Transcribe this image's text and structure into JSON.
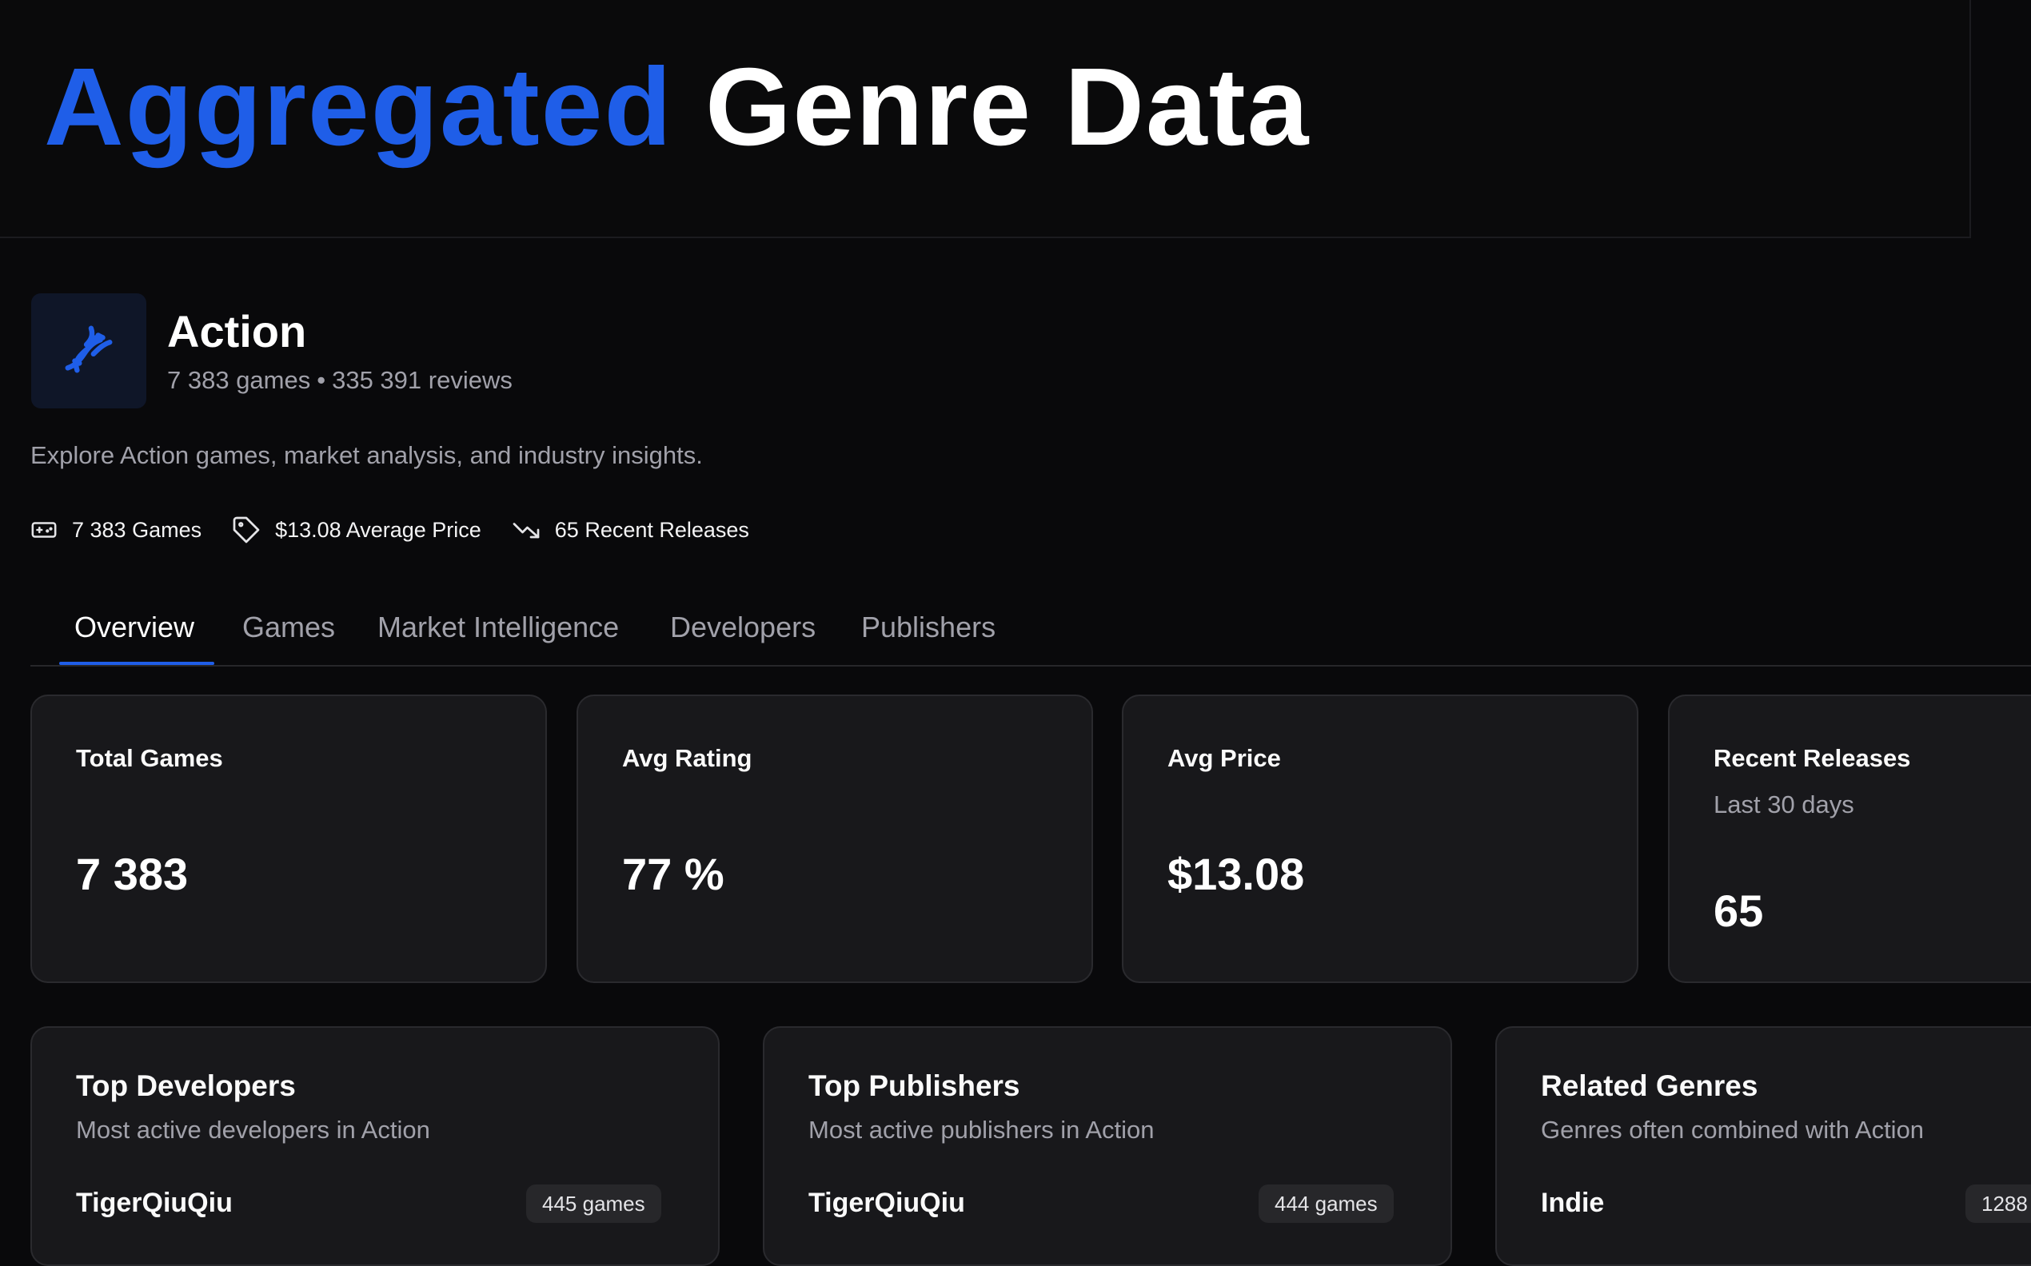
{
  "hero": {
    "title_accent": "Aggregated",
    "title_rest": "Genre Data"
  },
  "genre": {
    "name": "Action",
    "games_count": "7 383 games",
    "separator": "•",
    "reviews_count": "335 391 reviews",
    "description": "Explore Action games, market analysis, and industry insights.",
    "logo_icon": "dna-icon"
  },
  "stats": [
    {
      "icon": "gamepad-icon",
      "label": "7 383 Games"
    },
    {
      "icon": "tag-icon",
      "label": "$13.08 Average Price"
    },
    {
      "icon": "trending-down-icon",
      "label": "65 Recent Releases"
    }
  ],
  "tabs": [
    {
      "label": "Overview",
      "active": true
    },
    {
      "label": "Games",
      "active": false
    },
    {
      "label": "Market Intelligence",
      "active": false
    },
    {
      "label": "Developers",
      "active": false
    },
    {
      "label": "Publishers",
      "active": false
    }
  ],
  "metrics": [
    {
      "label": "Total Games",
      "value": "7 383"
    },
    {
      "label": "Avg Rating",
      "value": "77 %"
    },
    {
      "label": "Avg Price",
      "value": "$13.08"
    },
    {
      "label": "Recent Releases",
      "sublabel": "Last 30 days",
      "value": "65"
    }
  ],
  "lists": [
    {
      "title": "Top Developers",
      "desc": "Most active developers in Action",
      "first_item": "TigerQiuQiu",
      "first_badge": "445 games"
    },
    {
      "title": "Top Publishers",
      "desc": "Most active publishers in Action",
      "first_item": "TigerQiuQiu",
      "first_badge": "444 games"
    },
    {
      "title": "Related Genres",
      "desc": "Genres often combined with Action",
      "first_item": "Indie",
      "first_badge": "1288"
    }
  ],
  "colors": {
    "accent": "#1f5ee8",
    "background": "#09090b",
    "card": "#18181b"
  }
}
